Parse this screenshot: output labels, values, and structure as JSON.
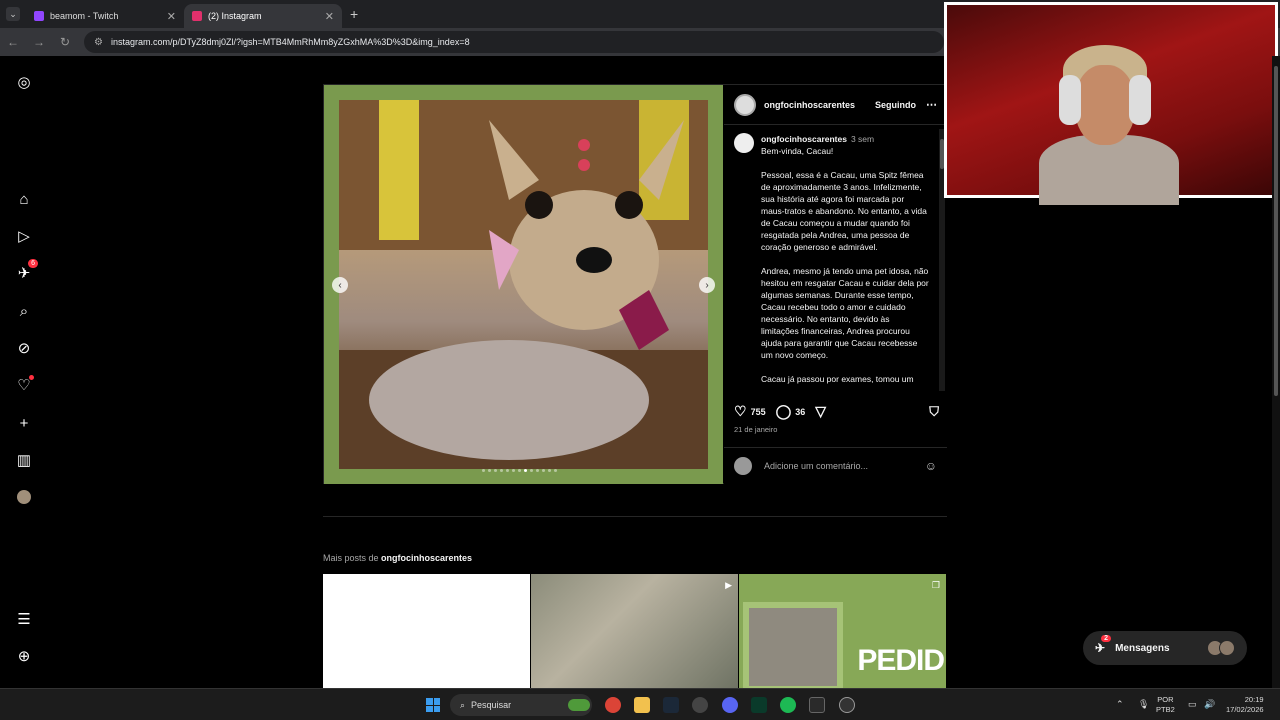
{
  "browser": {
    "tabs": [
      {
        "title": "beamom - Twitch",
        "color": "#9146ff"
      },
      {
        "title": "(2) Instagram",
        "color": "#e1306c",
        "active": true
      }
    ],
    "new_tab": "+",
    "url": "instagram.com/p/DTyZ8dmj0Zl/?igsh=MTB4MmRhMm8yZGxhMA%3D%3D&img_index=8"
  },
  "sidebar": {
    "items": [
      {
        "name": "instagram-logo-icon",
        "glyph": "◎"
      },
      {
        "name": "home-icon",
        "glyph": "⌂"
      },
      {
        "name": "reels-icon",
        "glyph": "▷"
      },
      {
        "name": "messages-icon",
        "glyph": "✈",
        "badge": "6"
      },
      {
        "name": "search-icon",
        "glyph": "⌕"
      },
      {
        "name": "explore-icon",
        "glyph": "⊘"
      },
      {
        "name": "notifications-icon",
        "glyph": "♡"
      },
      {
        "name": "create-icon",
        "glyph": "+"
      },
      {
        "name": "dashboard-icon",
        "glyph": "▥"
      },
      {
        "name": "profile-icon",
        "glyph": "●"
      },
      {
        "name": "menu-icon",
        "glyph": "☰"
      },
      {
        "name": "threads-icon",
        "glyph": "⊕"
      }
    ]
  },
  "post": {
    "username": "ongfocinhoscarentes",
    "follow_label": "Seguindo",
    "caption_user": "ongfocinhoscarentes",
    "caption_time": "3 sem",
    "caption_first": "Bem-vinda, Cacau!",
    "caption_body": "Pessoal, essa é a Cacau, uma Spitz fêmea de aproximadamente 3 anos. Infelizmente, sua história até agora foi marcada por maus-tratos e abandono. No entanto, a vida de Cacau começou a mudar quando foi resgatada pela Andrea, uma pessoa de coração generoso e admirável.\n\nAndrea, mesmo já tendo uma pet idosa, não hesitou em resgatar Cacau e cuidar dela por algumas semanas. Durante esse tempo, Cacau recebeu todo o amor e cuidado necessário. No entanto, devido às limitações financeiras, Andrea procurou ajuda para garantir que Cacau recebesse um novo começo.\n\nCacau já passou por exames, tomou um",
    "likes": "755",
    "comments": "36",
    "date": "21 de janeiro",
    "comment_placeholder": "Adicione um comentário...",
    "carousel_total": 13,
    "carousel_index": 8
  },
  "more": {
    "prefix": "Mais posts de ",
    "username": "ongfocinhoscarentes",
    "tile3_text": "PEDID"
  },
  "messages": {
    "label": "Mensagens",
    "badge": "2"
  },
  "taskbar": {
    "search_placeholder": "Pesquisar",
    "lang_top": "POR",
    "lang_bottom": "PTB2",
    "time": "20:19",
    "date": "17/02/2026"
  }
}
